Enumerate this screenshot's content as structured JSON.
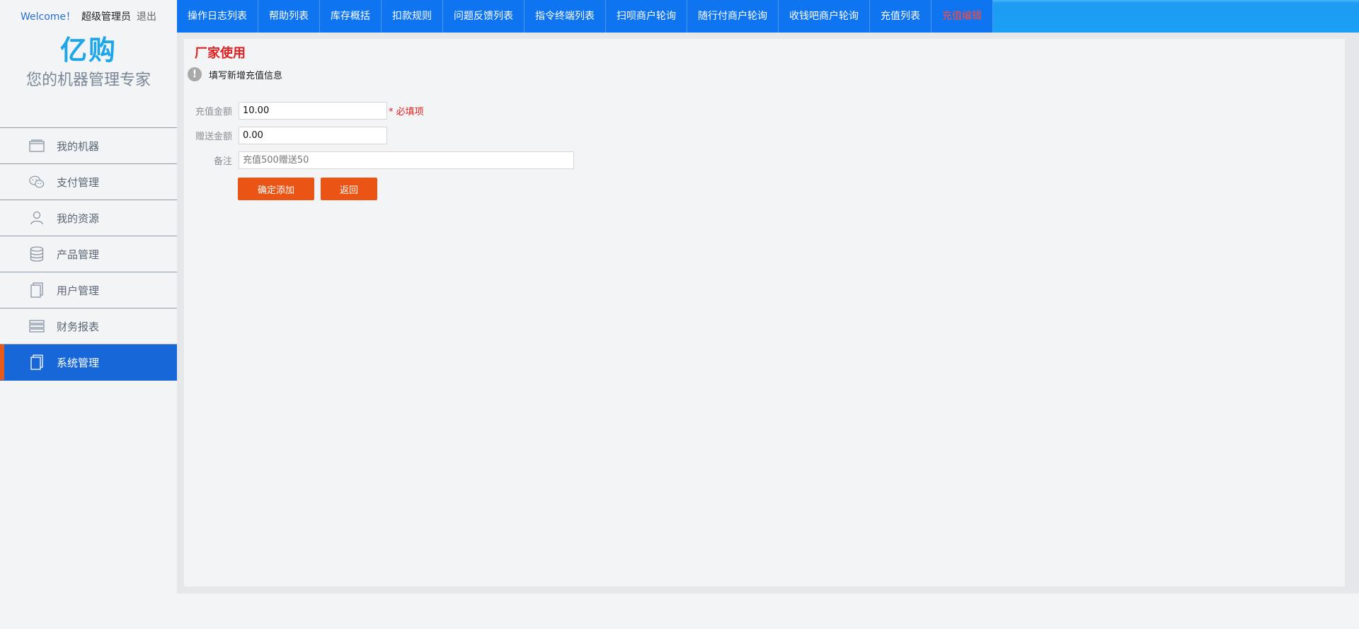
{
  "header": {
    "welcome": "Welcome！",
    "user": "超级管理员",
    "logout": "退出"
  },
  "brand": {
    "logo": "亿购",
    "slogan": "您的机器管理专家"
  },
  "sidebar": {
    "items": [
      {
        "label": "我的机器",
        "icon": "window-icon"
      },
      {
        "label": "支付管理",
        "icon": "wechat-icon"
      },
      {
        "label": "我的资源",
        "icon": "user-icon"
      },
      {
        "label": "产品管理",
        "icon": "database-icon"
      },
      {
        "label": "用户管理",
        "icon": "document-icon"
      },
      {
        "label": "财务报表",
        "icon": "layers-icon"
      },
      {
        "label": "系统管理",
        "icon": "document-icon",
        "active": true
      }
    ]
  },
  "topnav": {
    "tabs": [
      "操作日志列表",
      "帮助列表",
      "库存概括",
      "扣款规则",
      "问题反馈列表",
      "指令终端列表",
      "扫呗商户轮询",
      "随行付商户轮询",
      "收钱吧商户轮询",
      "充值列表",
      "充值编辑"
    ],
    "current_index": 10
  },
  "panel": {
    "title": "厂家使用",
    "hint": "填写新增充值信息"
  },
  "form": {
    "amount_label": "充值金额",
    "amount_value": "10.00",
    "required_text": "* 必填项",
    "bonus_label": "赠送金额",
    "bonus_value": "0.00",
    "remark_label": "备注",
    "remark_placeholder": "充值500赠送50",
    "submit_label": "确定添加",
    "back_label": "返回"
  },
  "colors": {
    "nav_blue": "#0e74f0",
    "active_menu": "#1767d8",
    "accent_orange": "#ea5515",
    "alert_red": "#e21f1f"
  }
}
